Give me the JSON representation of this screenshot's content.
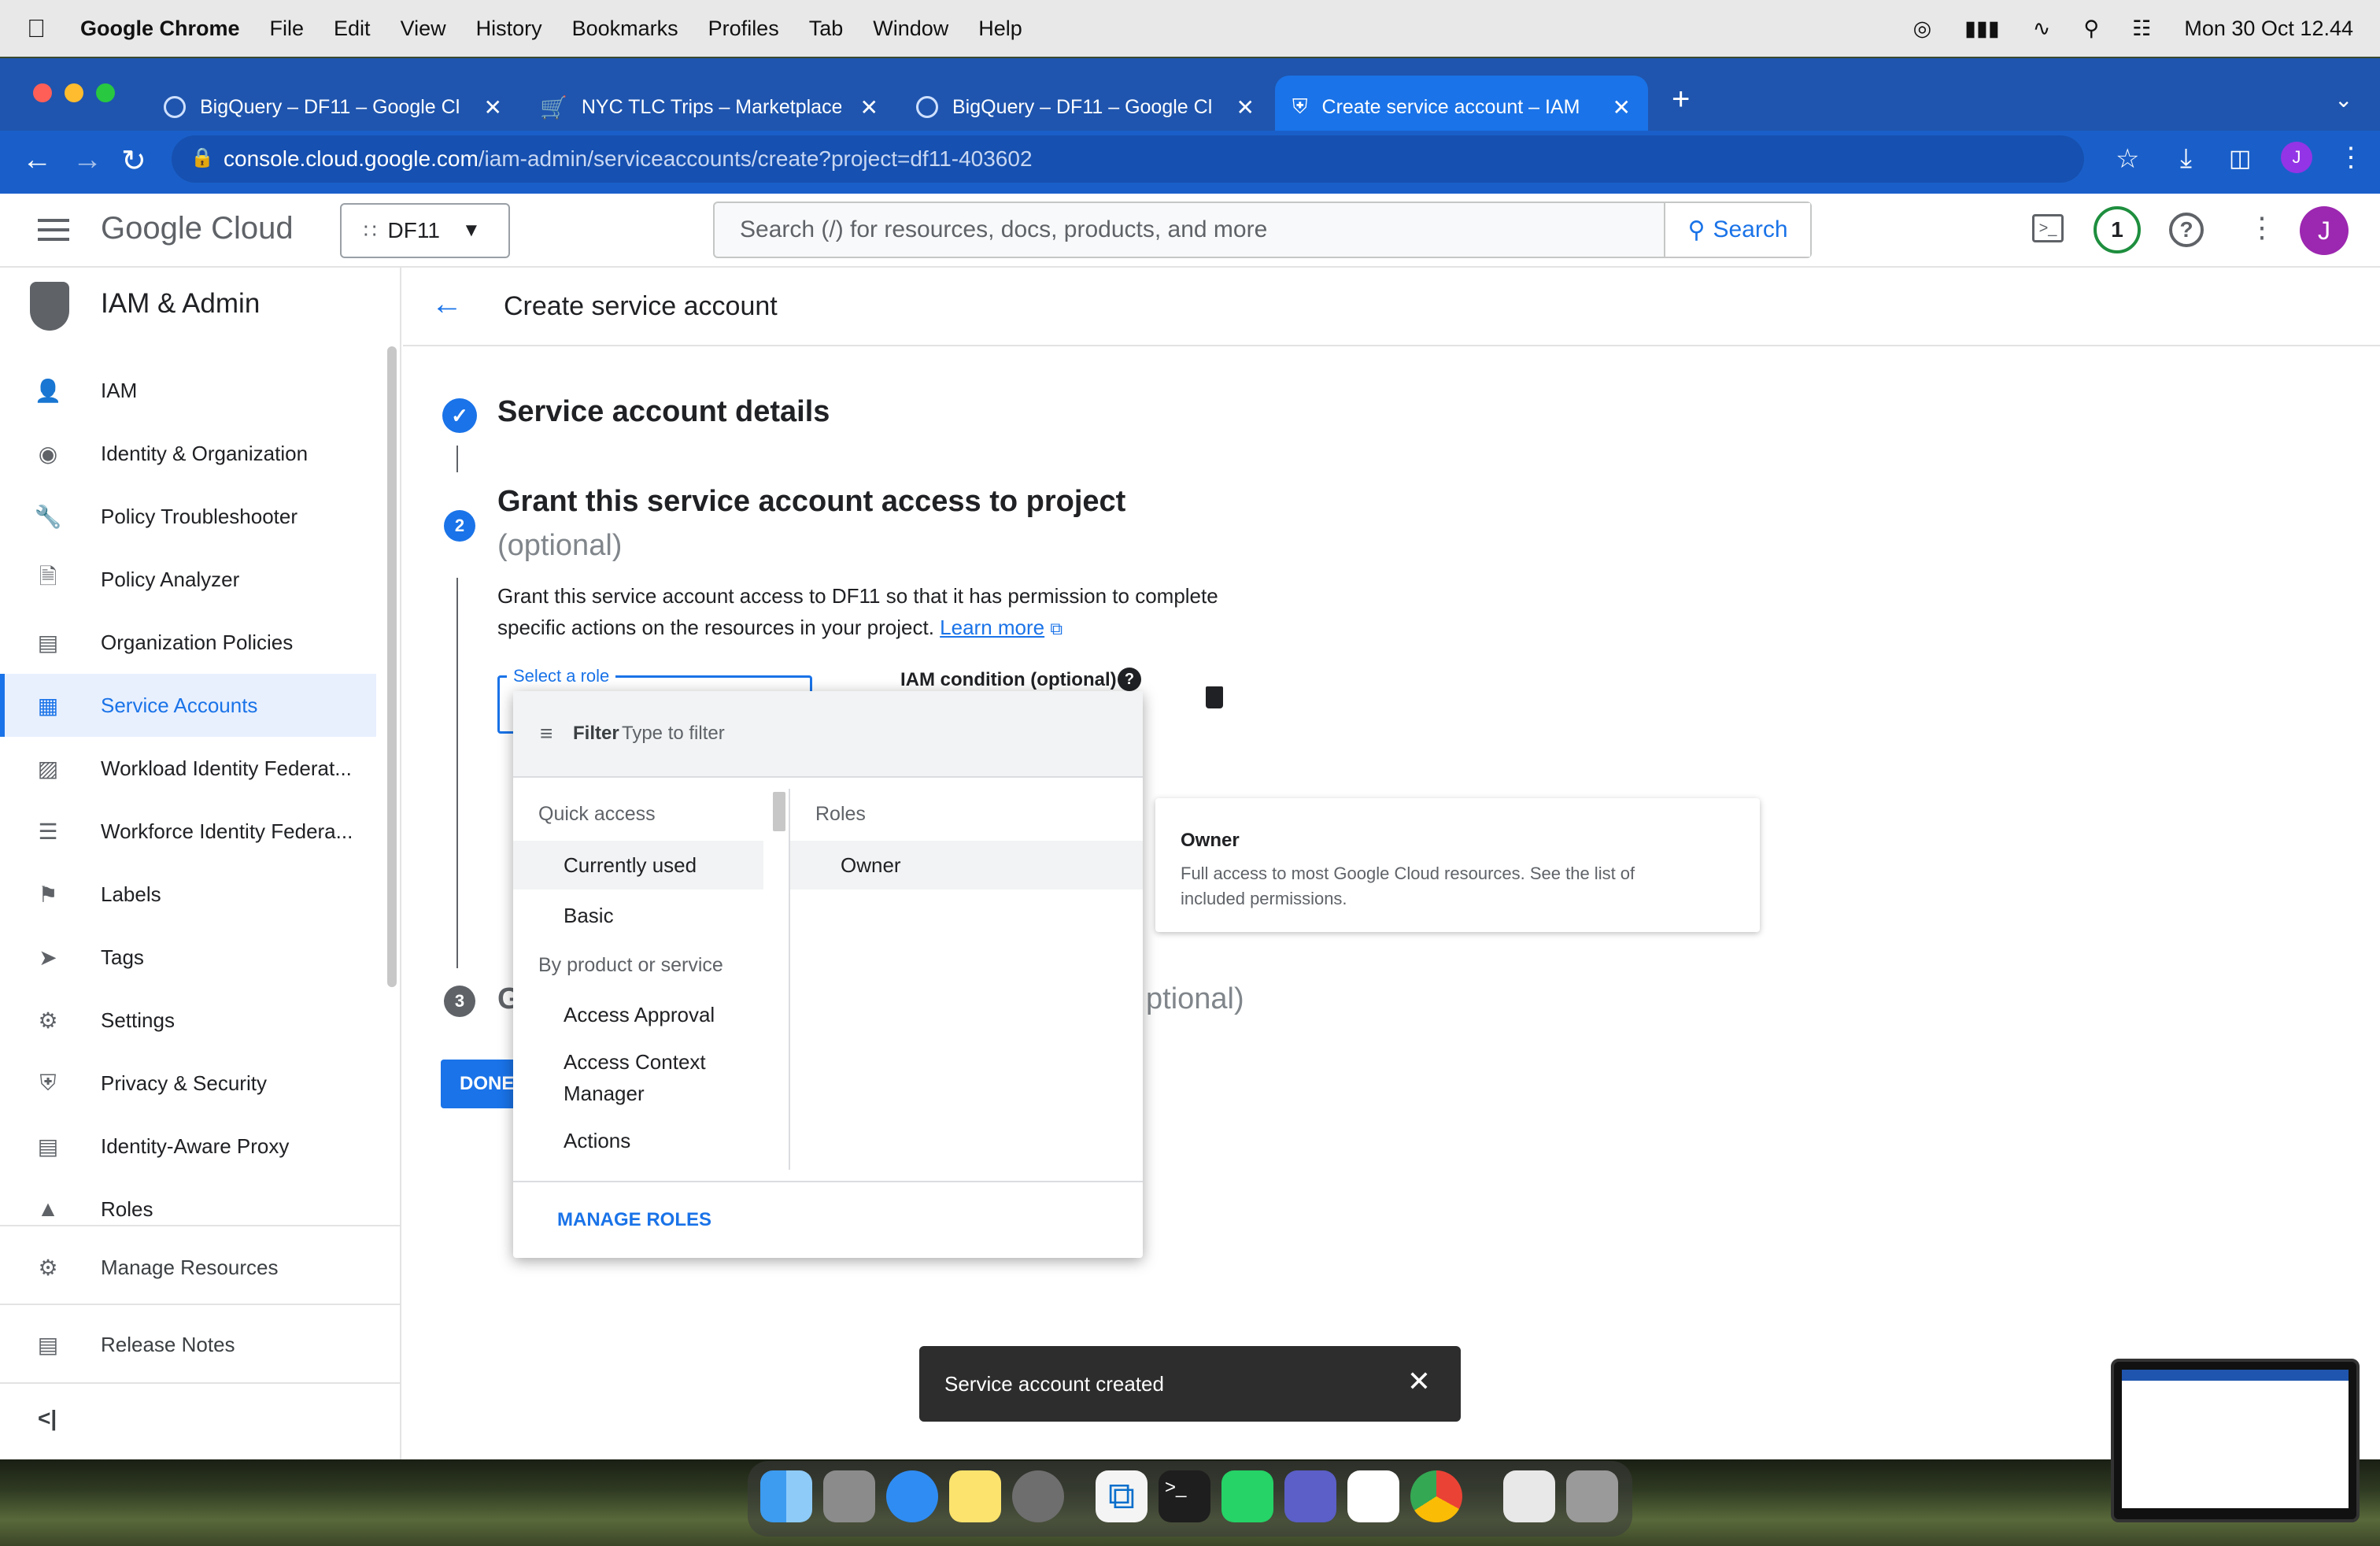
{
  "menubar": {
    "app": "Google Chrome",
    "items": [
      "File",
      "Edit",
      "View",
      "History",
      "Bookmarks",
      "Profiles",
      "Tab",
      "Window",
      "Help"
    ],
    "datetime": "Mon 30 Oct  12.44"
  },
  "tabs": [
    {
      "title": "BigQuery – DF11 – Google Clo"
    },
    {
      "title": "NYC TLC Trips – Marketplace"
    },
    {
      "title": "BigQuery – DF11 – Google Clo"
    },
    {
      "title": "Create service account – IAM"
    }
  ],
  "address": {
    "host": "console.cloud.google.com",
    "path": "/iam-admin/serviceaccounts/create?project=df11-403602"
  },
  "profile_initial": "J",
  "console": {
    "logo": "Google Cloud",
    "project": "DF11",
    "search_placeholder": "Search (/) for resources, docs, products, and more",
    "search_button": "Search",
    "notifications": "1",
    "avatar": "J"
  },
  "sidebar": {
    "title": "IAM & Admin",
    "items": [
      {
        "label": "IAM",
        "icon": "person-add-icon"
      },
      {
        "label": "Identity & Organization",
        "icon": "account-circle-icon"
      },
      {
        "label": "Policy Troubleshooter",
        "icon": "wrench-icon"
      },
      {
        "label": "Policy Analyzer",
        "icon": "document-search-icon"
      },
      {
        "label": "Organization Policies",
        "icon": "list-doc-icon"
      },
      {
        "label": "Service Accounts",
        "icon": "service-account-icon"
      },
      {
        "label": "Workload Identity Federat...",
        "icon": "id-card-icon"
      },
      {
        "label": "Workforce Identity Federa...",
        "icon": "list-icon"
      },
      {
        "label": "Labels",
        "icon": "label-icon"
      },
      {
        "label": "Tags",
        "icon": "tag-icon"
      },
      {
        "label": "Settings",
        "icon": "gear-icon"
      },
      {
        "label": "Privacy & Security",
        "icon": "shield-icon"
      },
      {
        "label": "Identity-Aware Proxy",
        "icon": "proxy-icon"
      },
      {
        "label": "Roles",
        "icon": "hat-icon"
      }
    ],
    "manage_resources": "Manage Resources",
    "release_notes": "Release Notes",
    "collapse": "<|"
  },
  "main": {
    "title": "Create service account",
    "step1": "Service account details",
    "step2": {
      "number": "2",
      "title": "Grant this service account access to project",
      "optional": "(optional)",
      "desc1": "Grant this service account access to DF11 so that it has permission to complete",
      "desc2": "specific actions on the resources in your project.",
      "learn_more": "Learn more"
    },
    "role_label": "Select a role",
    "iam_condition": "IAM condition (optional)",
    "step3": {
      "number": "3",
      "title_start": "G",
      "title_end": "ptional)"
    },
    "done": "DONE"
  },
  "dropdown": {
    "filter_label": "Filter",
    "filter_placeholder": "Type to filter",
    "quick_access": "Quick access",
    "currently_used": "Currently used",
    "basic": "Basic",
    "by_product": "By product or service",
    "access_approval": "Access Approval",
    "acm_line1": "Access Context",
    "acm_line2": "Manager",
    "actions": "Actions",
    "roles_header": "Roles",
    "owner": "Owner",
    "manage_roles": "MANAGE ROLES"
  },
  "owner_card": {
    "title": "Owner",
    "desc1": "Full access to most Google Cloud resources. See the list of",
    "desc2": "included permissions."
  },
  "toast": {
    "message": "Service account created"
  }
}
